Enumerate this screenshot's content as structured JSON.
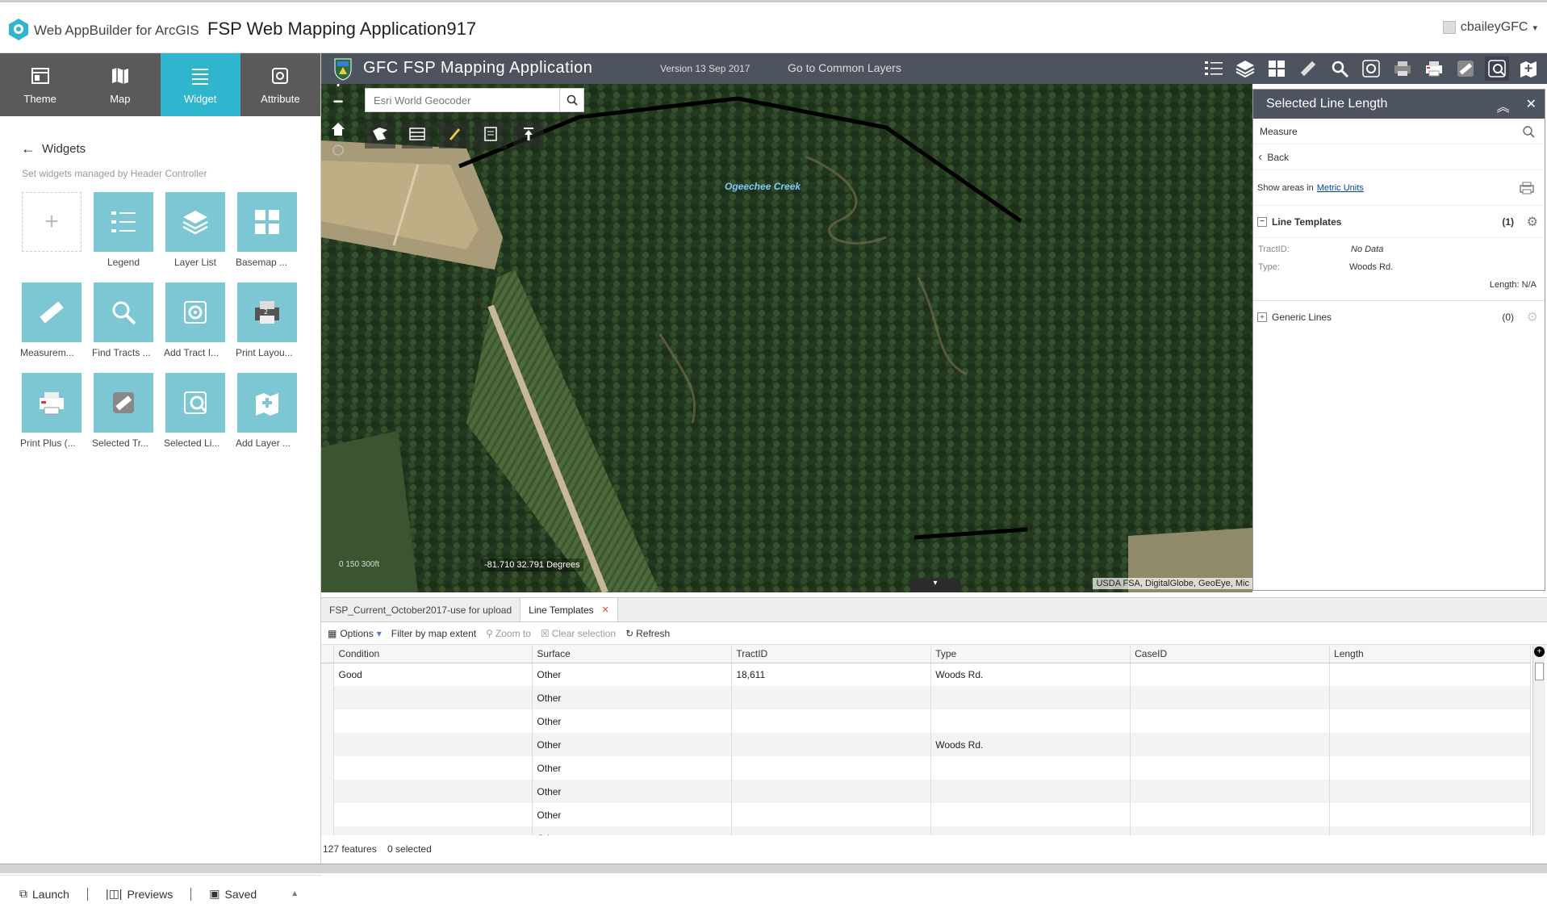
{
  "topbar": {
    "brand": "Web AppBuilder for ArcGIS",
    "app_title": "FSP Web Mapping Application917",
    "user": "cbaileyGFC"
  },
  "builder_tabs": [
    {
      "label": "Theme",
      "icon": "theme-icon"
    },
    {
      "label": "Map",
      "icon": "map-icon"
    },
    {
      "label": "Widget",
      "icon": "widget-icon",
      "active": true
    },
    {
      "label": "Attribute",
      "icon": "attribute-icon"
    }
  ],
  "widgets_panel": {
    "title": "Widgets",
    "subtitle": "Set widgets managed by Header Controller",
    "items": [
      {
        "label": "",
        "icon": "add-icon"
      },
      {
        "label": "Legend",
        "icon": "legend-icon"
      },
      {
        "label": "Layer List",
        "icon": "layers-icon"
      },
      {
        "label": "Basemap ...",
        "icon": "basemap-icon"
      },
      {
        "label": "Measurem...",
        "icon": "ruler-icon"
      },
      {
        "label": "Find Tracts ...",
        "icon": "search-icon"
      },
      {
        "label": "Add Tract I...",
        "icon": "gear-icon"
      },
      {
        "label": "Print Layou...",
        "icon": "print-layout-icon"
      },
      {
        "label": "Print Plus (...",
        "icon": "printer-icon"
      },
      {
        "label": "Selected Tr...",
        "icon": "selected-tract-icon"
      },
      {
        "label": "Selected Li...",
        "icon": "selected-line-icon"
      },
      {
        "label": "Add Layer ...",
        "icon": "add-layer-icon"
      }
    ]
  },
  "builder_footer": {
    "launch": "Launch",
    "previews": "Previews",
    "saved": "Saved"
  },
  "app_header": {
    "title": "GFC FSP Mapping Application",
    "version": "Version 13 Sep 2017",
    "link": "Go to Common Layers"
  },
  "map": {
    "search_placeholder": "Esri World Geocoder",
    "creek_label": "Ogeechee Creek",
    "coords": "-81.710 32.791 Degrees",
    "attribution": "USDA FSA, DigitalGlobe, GeoEye, Mic",
    "scale": "0    150    300ft"
  },
  "measure_panel": {
    "title": "Selected Line Length",
    "search_value": "Measure",
    "back": "Back",
    "show_areas_prefix": "Show areas in",
    "units_link": "Metric Units",
    "line_templates": {
      "label": "Line Templates",
      "count": "(1)",
      "tract_label": "TractID:",
      "tract_value": "No Data",
      "type_label": "Type:",
      "type_value": "Woods Rd.",
      "length": "Length: N/A"
    },
    "generic_lines": {
      "label": "Generic Lines",
      "count": "(0)"
    }
  },
  "attribute_table": {
    "tabs": [
      {
        "label": "FSP_Current_October2017-use for upload"
      },
      {
        "label": "Line Templates",
        "active": true
      }
    ],
    "toolbar": {
      "options": "Options",
      "filter": "Filter by map extent",
      "zoom": "Zoom to",
      "clear": "Clear selection",
      "refresh": "Refresh"
    },
    "columns": [
      "Condition",
      "Surface",
      "TractID",
      "Type",
      "CaseID",
      "Length"
    ],
    "rows": [
      [
        "Good",
        "Other",
        "18,611",
        "Woods Rd.",
        "",
        ""
      ],
      [
        "",
        "Other",
        "",
        "",
        "",
        ""
      ],
      [
        "",
        "Other",
        "",
        "",
        "",
        ""
      ],
      [
        "",
        "Other",
        "",
        "Woods Rd.",
        "",
        ""
      ],
      [
        "",
        "Other",
        "",
        "",
        "",
        ""
      ],
      [
        "",
        "Other",
        "",
        "",
        "",
        ""
      ],
      [
        "",
        "Other",
        "",
        "",
        "",
        ""
      ],
      [
        "",
        "Other",
        "",
        "",
        "",
        ""
      ]
    ],
    "status": "127 features    0 selected"
  }
}
